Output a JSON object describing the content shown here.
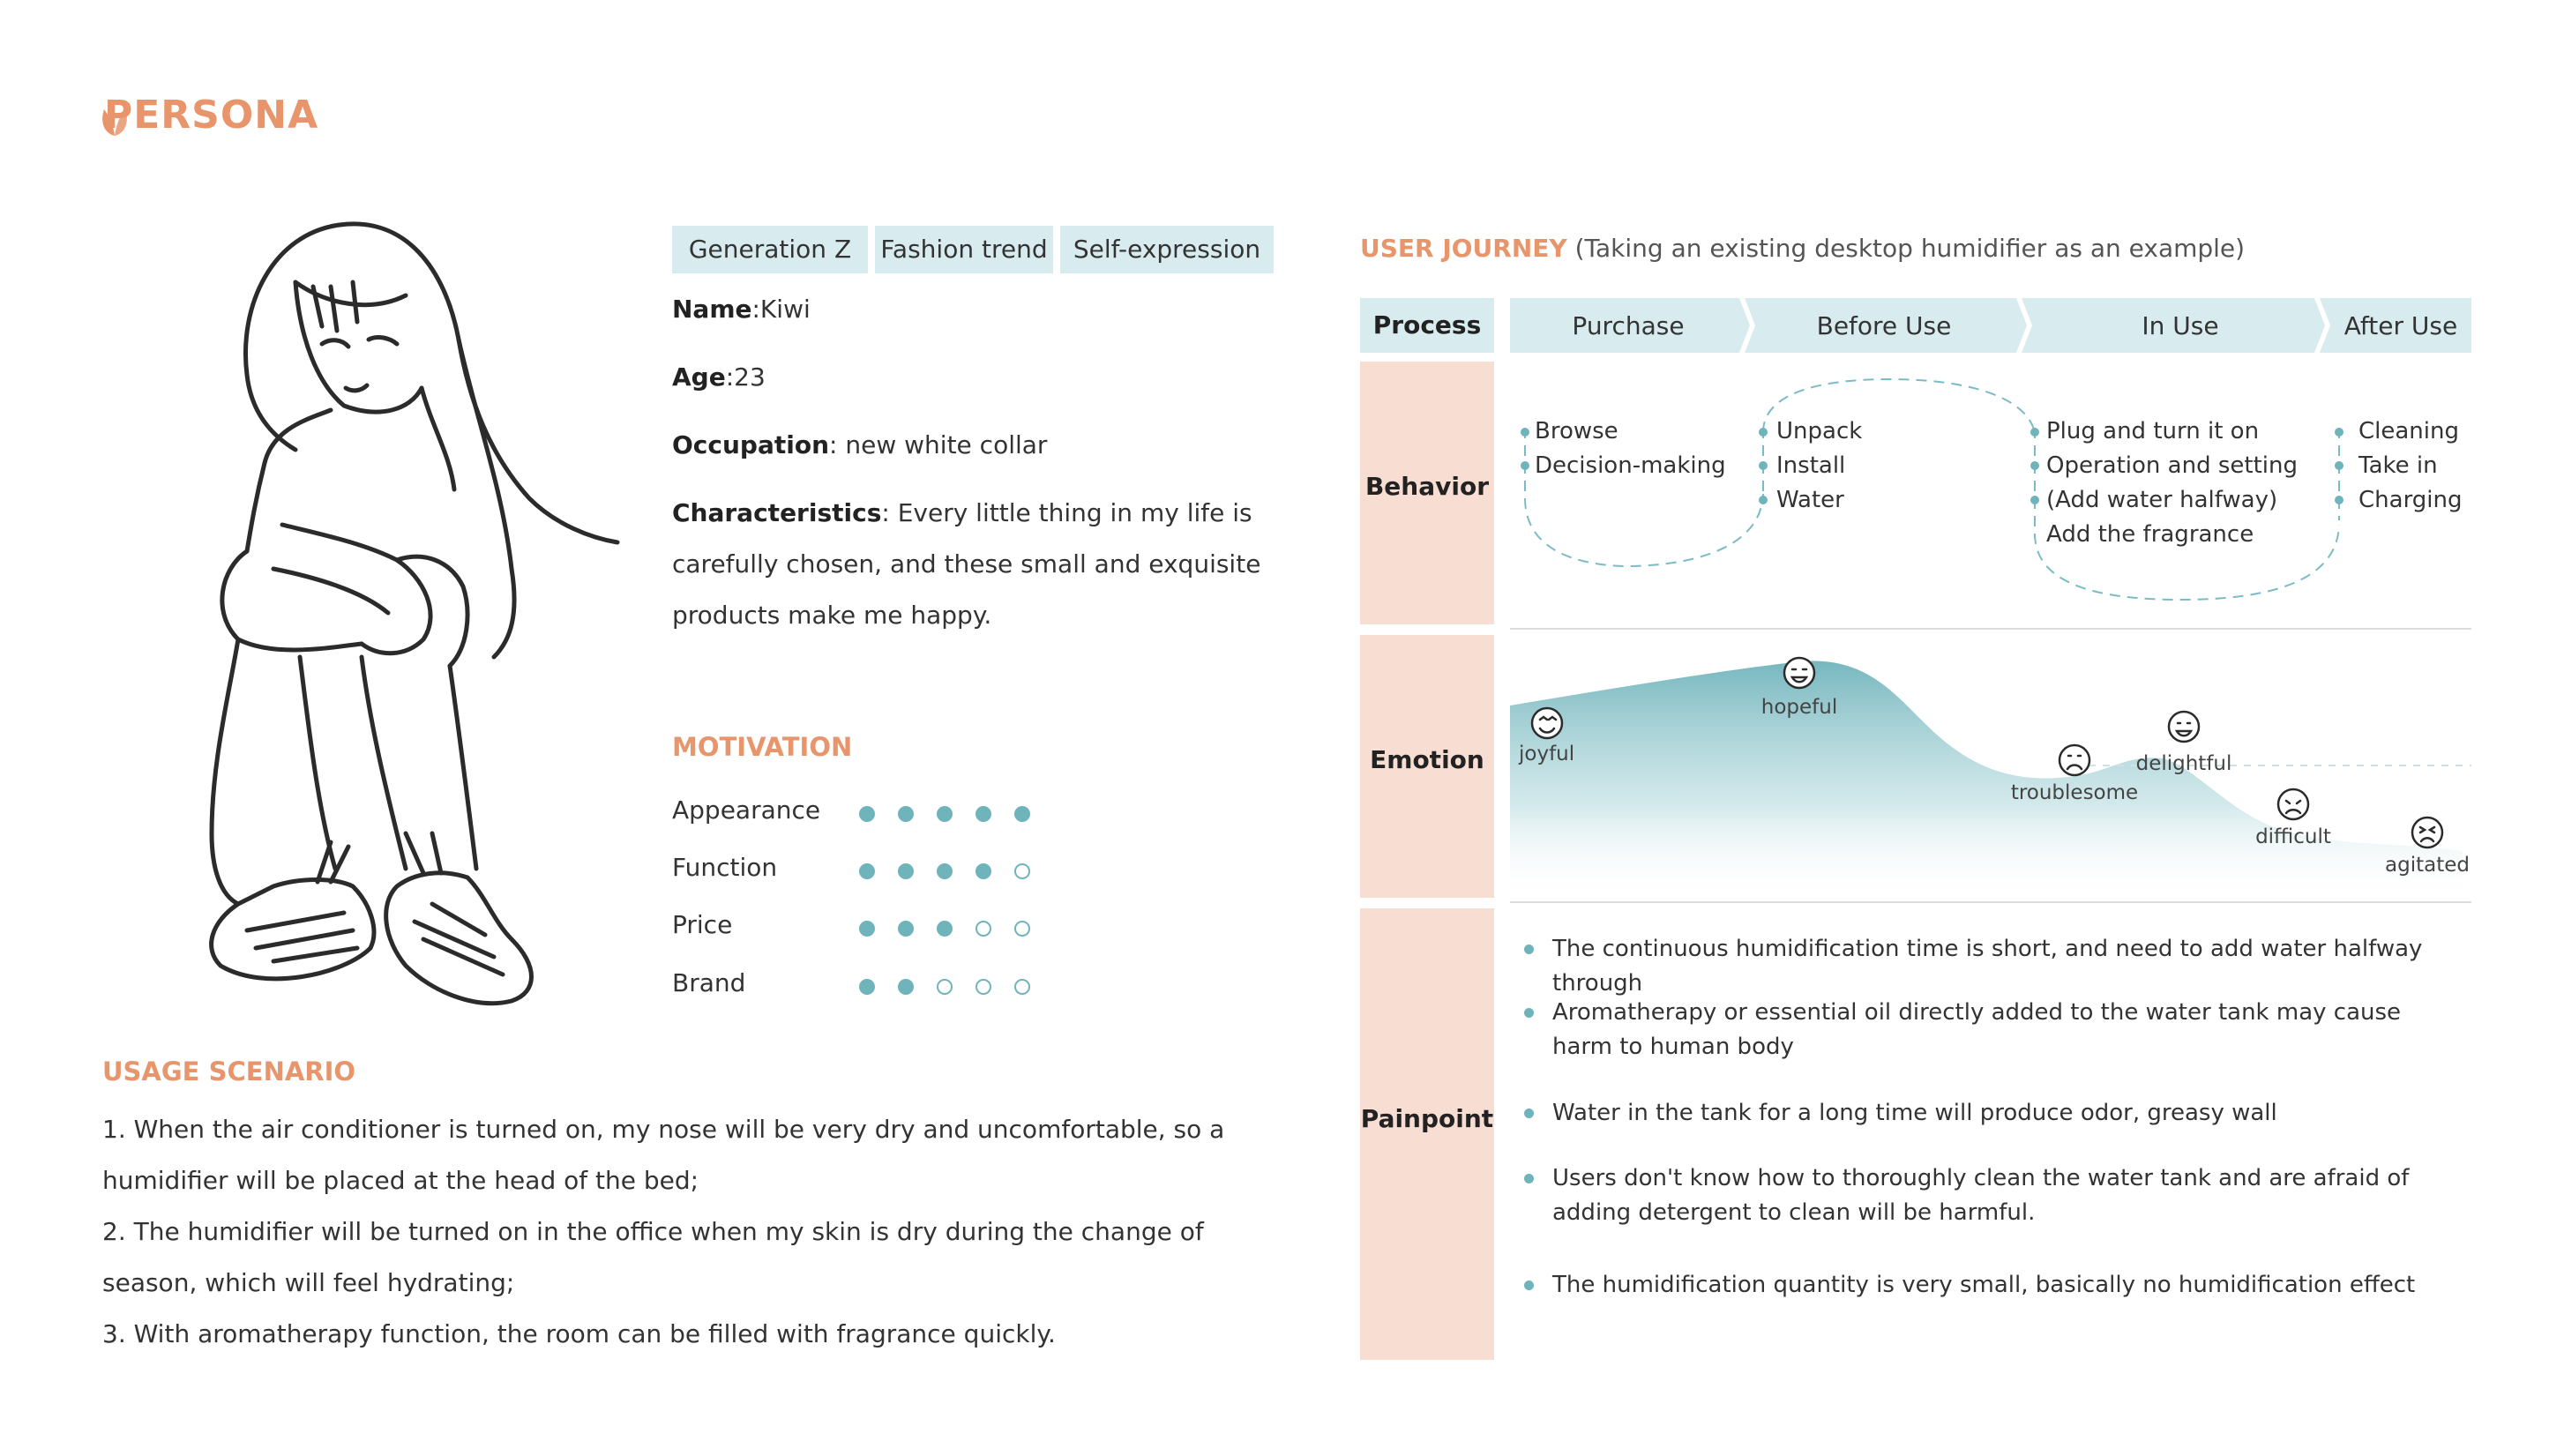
{
  "brand": {
    "title": "PERSONA"
  },
  "tags": [
    "Generation Z",
    "Fashion trend",
    "Self-expression"
  ],
  "profile": {
    "name_label": "Name",
    "name_value": ":Kiwi",
    "age_label": "Age",
    "age_value": ":23",
    "occupation_label": "Occupation",
    "occupation_value": ": new white collar",
    "characteristics_label": "Characteristics",
    "characteristics_value": ": Every little thing in my life is carefully chosen, and these small and exquisite products make me happy."
  },
  "motivation": {
    "title": "MOTIVATION",
    "max": 5,
    "items": [
      {
        "label": "Appearance",
        "score": 5
      },
      {
        "label": "Function",
        "score": 4
      },
      {
        "label": "Price",
        "score": 3
      },
      {
        "label": "Brand",
        "score": 2
      }
    ]
  },
  "usage": {
    "title": "USAGE SCENARIO",
    "lines": [
      "1. When the air conditioner is turned on, my nose will be very dry and uncomfortable, so a humidifier will be placed at the head of the bed;",
      "2. The humidifier will be turned on in the office when my skin is dry during the change of season, which will feel hydrating;",
      "3. With aromatherapy function, the room can be filled with fragrance quickly."
    ]
  },
  "journey": {
    "title": "USER JOURNEY",
    "subtitle": "(Taking an existing desktop humidifier as an example)",
    "rows": {
      "process": "Process",
      "behavior": "Behavior",
      "emotion": "Emotion",
      "painpoint": "Painpoint"
    },
    "stages": [
      "Purchase",
      "Before Use",
      "In Use",
      "After Use"
    ],
    "behaviors": [
      [
        "Browse",
        "Decision-making"
      ],
      [
        "Unpack",
        "Install",
        "Water"
      ],
      [
        "Plug and turn it on",
        "Operation and setting",
        "(Add water halfway)",
        "Add the fragrance"
      ],
      [
        "Cleaning",
        "Take in",
        "Charging"
      ]
    ],
    "emotions": [
      "joyful",
      "hopeful",
      "troublesome",
      "delightful",
      "difficult",
      "agitated"
    ],
    "painpoints": [
      "The continuous humidification time is short, and need to add water halfway through",
      "Aromatherapy or essential oil directly added to the water tank may cause harm to human body",
      "Water in the tank for a long time will produce odor, greasy wall",
      "Users don't know how to thoroughly clean the water tank and are afraid of adding detergent to clean will be harmful.",
      "The humidification quantity is very small, basically no humidification effect"
    ],
    "colors": {
      "accent": "#e8956c",
      "teal": "#6fb3bb",
      "light_teal": "#d8ecef",
      "pink": "#f8ddd3"
    }
  }
}
